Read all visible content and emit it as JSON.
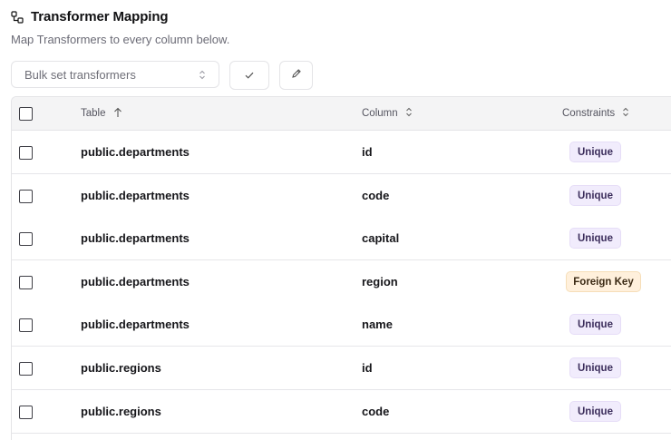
{
  "header": {
    "title": "Transformer Mapping",
    "subtitle": "Map Transformers to every column below."
  },
  "toolbar": {
    "bulk_select_placeholder": "Bulk set transformers"
  },
  "table": {
    "columns": {
      "table": "Table",
      "column": "Column",
      "constraints": "Constraints"
    },
    "rows": [
      {
        "table": "public.departments",
        "column": "id",
        "constraint": "Unique"
      },
      {
        "table": "public.departments",
        "column": "code",
        "constraint": "Unique"
      },
      {
        "table": "public.departments",
        "column": "capital",
        "constraint": "Unique"
      },
      {
        "table": "public.departments",
        "column": "region",
        "constraint": "Foreign Key"
      },
      {
        "table": "public.departments",
        "column": "name",
        "constraint": "Unique"
      },
      {
        "table": "public.regions",
        "column": "id",
        "constraint": "Unique"
      },
      {
        "table": "public.regions",
        "column": "code",
        "constraint": "Unique"
      }
    ]
  },
  "colors": {
    "unique_badge_bg": "#f1ecfc",
    "foreign_key_badge_bg": "#fff0dc",
    "header_bg": "#f4f4f5"
  }
}
